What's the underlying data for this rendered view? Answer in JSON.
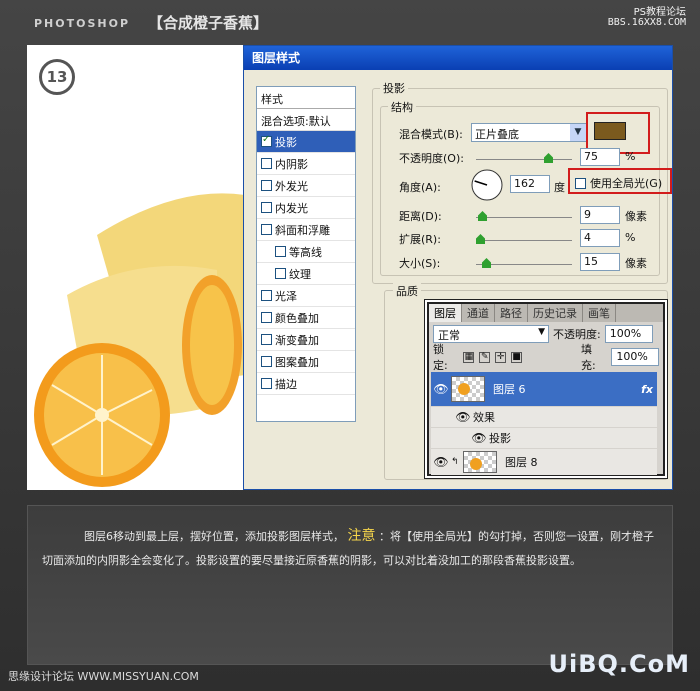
{
  "header": {
    "brand": "PHOTOSHOP",
    "title": "【合成橙子香蕉】",
    "site_name": "PS教程论坛",
    "site_url": "BBS.16XX8.COM"
  },
  "photo": {
    "step_badge": "13"
  },
  "dialog": {
    "title": "图层样式",
    "styles_list": {
      "header": "样式",
      "blend_options": "混合选项:默认",
      "items": [
        {
          "label": "投影",
          "checked": true,
          "selected": true,
          "indent": false
        },
        {
          "label": "内阴影",
          "checked": false,
          "selected": false,
          "indent": false
        },
        {
          "label": "外发光",
          "checked": false,
          "selected": false,
          "indent": false
        },
        {
          "label": "内发光",
          "checked": false,
          "selected": false,
          "indent": false
        },
        {
          "label": "斜面和浮雕",
          "checked": false,
          "selected": false,
          "indent": false
        },
        {
          "label": "等高线",
          "checked": false,
          "selected": false,
          "indent": true
        },
        {
          "label": "纹理",
          "checked": false,
          "selected": false,
          "indent": true
        },
        {
          "label": "光泽",
          "checked": false,
          "selected": false,
          "indent": false
        },
        {
          "label": "颜色叠加",
          "checked": false,
          "selected": false,
          "indent": false
        },
        {
          "label": "渐变叠加",
          "checked": false,
          "selected": false,
          "indent": false
        },
        {
          "label": "图案叠加",
          "checked": false,
          "selected": false,
          "indent": false
        },
        {
          "label": "描边",
          "checked": false,
          "selected": false,
          "indent": false
        }
      ]
    },
    "drop_shadow": {
      "group_label": "投影",
      "structure_label": "结构",
      "blend_mode_label": "混合模式(B):",
      "blend_mode_value": "正片叠底",
      "shadow_color": "#7b5a1e",
      "opacity_label": "不透明度(O):",
      "opacity_value": "75",
      "opacity_unit": "%",
      "angle_label": "角度(A):",
      "angle_value": "162",
      "angle_unit": "度",
      "global_light_label": "使用全局光(G)",
      "global_light_checked": false,
      "distance_label": "距离(D):",
      "distance_value": "9",
      "distance_unit": "像素",
      "spread_label": "扩展(R):",
      "spread_value": "4",
      "spread_unit": "%",
      "size_label": "大小(S):",
      "size_value": "15",
      "size_unit": "像素"
    },
    "quality_label": "品质",
    "highlight_color": "#d21c1c"
  },
  "layers_panel": {
    "tabs": [
      "图层",
      "通道",
      "路径",
      "历史记录",
      "画笔"
    ],
    "blend_mode": "正常",
    "opacity_label": "不透明度:",
    "opacity_value": "100%",
    "lock_label": "锁定:",
    "fill_label": "填充:",
    "fill_value": "100%",
    "rows": {
      "layer6": "图层 6",
      "effects": "效果",
      "drop_shadow": "投影",
      "layer8": "图层 8"
    }
  },
  "caption": {
    "text1": "图层6移动到最上层，摆好位置，添加投影图层样式，",
    "highlight": "注意",
    "text2": "：将【使用全局光】的勾打掉，否则您一设置，刚才橙子切面添加的内阴影全会变化了。投影设置的要尽量接近原香蕉的阴影，可以对比着没加工的那段香蕉投影设置。"
  },
  "footer": {
    "left": "思缘设计论坛 WWW.MISSYUAN.COM",
    "right": "UiBQ.CoM"
  }
}
